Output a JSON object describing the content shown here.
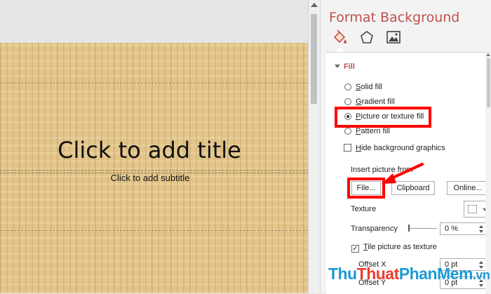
{
  "slide": {
    "title": "Click to add title",
    "subtitle": "Click to add subtitle"
  },
  "panel": {
    "title": "Format Background",
    "tabs": [
      {
        "icon": "fill-bucket-icon",
        "active": true
      },
      {
        "icon": "pentagon-effects-icon",
        "active": false
      },
      {
        "icon": "picture-icon",
        "active": false
      }
    ],
    "section": "Fill",
    "fill_options": [
      {
        "key": "S",
        "rest": "olid fill",
        "checked": false
      },
      {
        "key": "G",
        "rest": "radient fill",
        "checked": false
      },
      {
        "key": "P",
        "rest": "icture or texture fill",
        "checked": true
      },
      {
        "key": "P",
        "rest": "attern fill",
        "checked": false
      }
    ],
    "hide_bg": {
      "key": "H",
      "rest": "ide background graphics",
      "checked": false
    },
    "insert_from": "Insert picture from",
    "buttons": {
      "file": "File...",
      "clipboard": "Clipboard",
      "online": "Online..."
    },
    "texture_label": "Texture",
    "transparency_label": "Transparency",
    "transparency_value": "0 %",
    "tile": {
      "key": "T",
      "rest": "ile picture as texture",
      "checked": true
    },
    "offset_x_label": "Offset X",
    "offset_x_value": "0 pt",
    "offset_y_label": "Offset Y",
    "offset_y_value": "0 pt"
  },
  "watermark": {
    "part1": "Thu",
    "part2": "Thuat",
    "part3": "PhanMem",
    "part4": ".vn"
  },
  "colors": {
    "accent": "#c0504d",
    "highlight": "#ff0000"
  }
}
